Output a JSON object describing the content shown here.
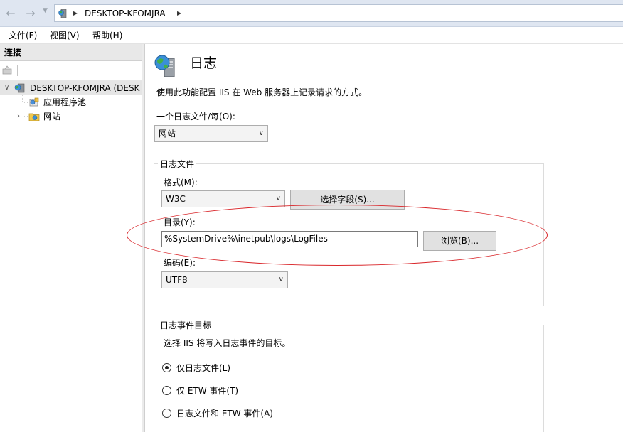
{
  "address": {
    "path": "DESKTOP-KFOMJRA"
  },
  "menu": {
    "items": [
      "文件(F)",
      "视图(V)",
      "帮助(H)"
    ]
  },
  "connections": {
    "header": "连接",
    "tree": {
      "server": "DESKTOP-KFOMJRA (DESK",
      "app_pools": "应用程序池",
      "sites": "网站"
    }
  },
  "main": {
    "title": "日志",
    "description": "使用此功能配置 IIS 在 Web 服务器上记录请求的方式。",
    "one_log_per_label": "一个日志文件/每(O):",
    "one_log_per_value": "网站",
    "log_file_group": {
      "title": "日志文件",
      "format_label": "格式(M):",
      "format_value": "W3C",
      "select_fields_button": "选择字段(S)...",
      "directory_label": "目录(Y):",
      "directory_value": "%SystemDrive%\\inetpub\\logs\\LogFiles",
      "browse_button": "浏览(B)...",
      "encoding_label": "编码(E):",
      "encoding_value": "UTF8"
    },
    "log_event_group": {
      "title": "日志事件目标",
      "description": "选择 IIS 将写入日志事件的目标。",
      "options": [
        "仅日志文件(L)",
        "仅 ETW 事件(T)",
        "日志文件和 ETW 事件(A)"
      ],
      "selected_index": 0
    }
  },
  "colors": {
    "annotation": "#d9262a",
    "address_bar": "#dfe6f1"
  }
}
